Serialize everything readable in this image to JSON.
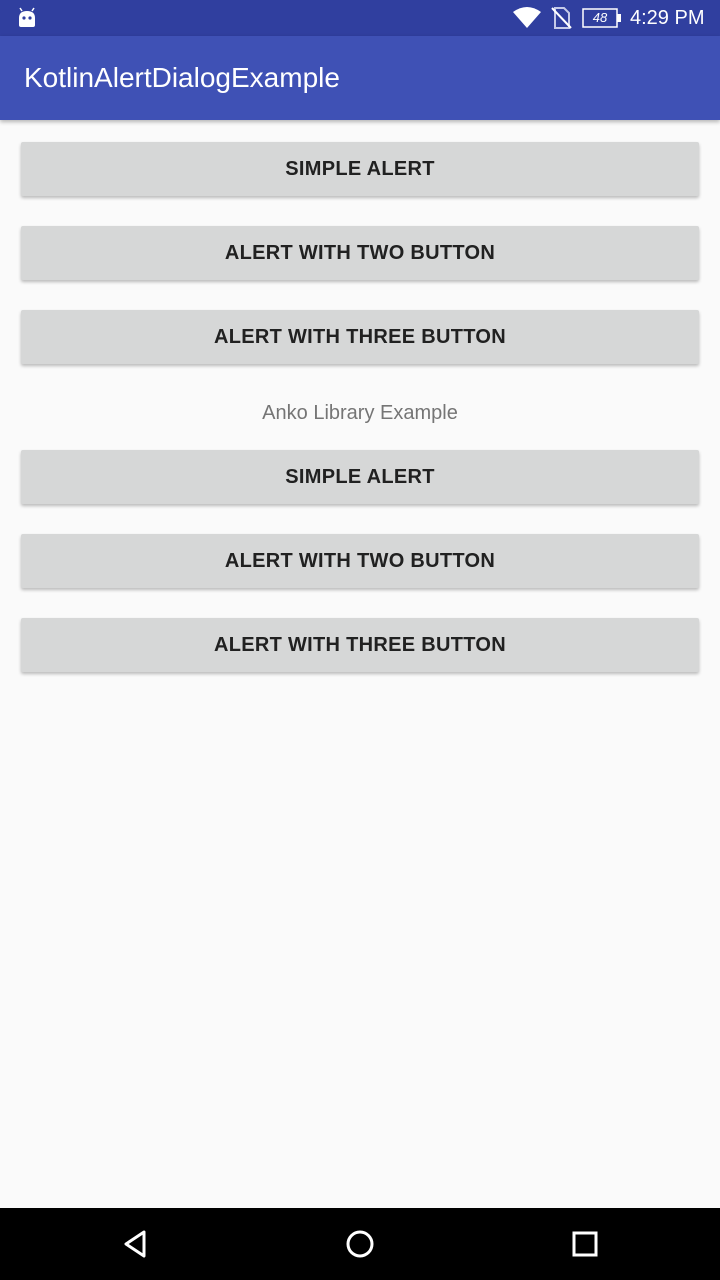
{
  "status_bar": {
    "time": "4:29 PM",
    "battery_level": "48",
    "icons": [
      "android-icon",
      "wifi-icon",
      "no-sim-icon",
      "battery-icon"
    ]
  },
  "app_bar": {
    "title": "KotlinAlertDialogExample"
  },
  "buttons_top": [
    {
      "label": "SIMPLE ALERT"
    },
    {
      "label": "ALERT WITH TWO BUTTON"
    },
    {
      "label": "ALERT WITH THREE BUTTON"
    }
  ],
  "section_label": "Anko Library Example",
  "buttons_bottom": [
    {
      "label": "SIMPLE ALERT"
    },
    {
      "label": "ALERT WITH TWO BUTTON"
    },
    {
      "label": "ALERT WITH THREE BUTTON"
    }
  ],
  "nav_bar": {
    "icons": [
      "back-icon",
      "home-icon",
      "recents-icon"
    ]
  },
  "colors": {
    "status_bar": "#303f9f",
    "app_bar": "#3f51b5",
    "background": "#fafafa",
    "button": "#d6d7d7",
    "button_text": "#212121",
    "section_text": "#757575"
  }
}
